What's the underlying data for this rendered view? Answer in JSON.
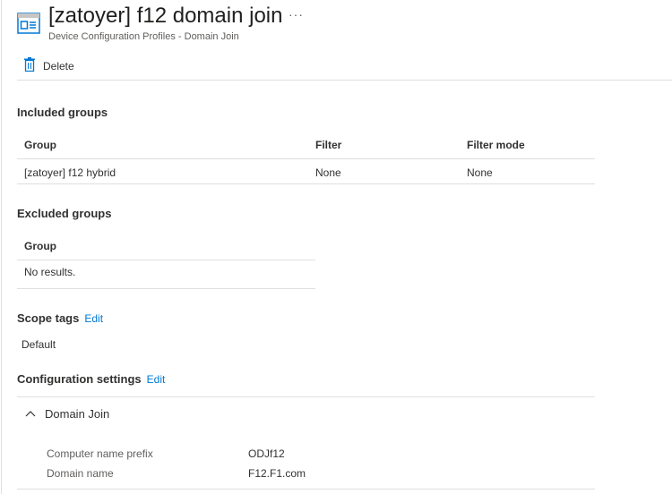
{
  "header": {
    "title": "[zatoyer] f12 domain join",
    "subtitle": "Device Configuration Profiles - Domain Join",
    "more": "···",
    "icon": "profile-window-icon"
  },
  "toolbar": {
    "delete_label": "Delete"
  },
  "included": {
    "heading": "Included groups",
    "columns": [
      "Group",
      "Filter",
      "Filter mode"
    ],
    "rows": [
      [
        "[zatoyer] f12 hybrid",
        "None",
        "None"
      ]
    ]
  },
  "excluded": {
    "heading": "Excluded groups",
    "columns": [
      "Group"
    ],
    "empty": "No results."
  },
  "scope": {
    "heading": "Scope tags",
    "edit": "Edit",
    "value": "Default"
  },
  "config": {
    "heading": "Configuration settings",
    "edit": "Edit",
    "section": "Domain Join",
    "settings": [
      {
        "label": "Computer name prefix",
        "value": "ODJf12"
      },
      {
        "label": "Domain name",
        "value": "F12.F1.com"
      }
    ]
  },
  "colors": {
    "accent": "#0078d4"
  }
}
